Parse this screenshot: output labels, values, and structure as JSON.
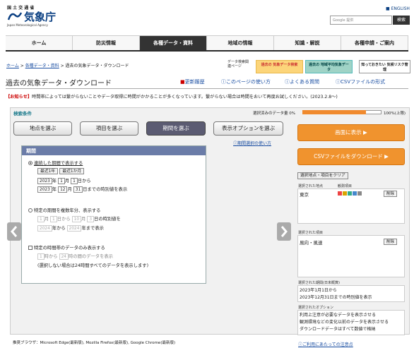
{
  "header": {
    "ministry": "国 土 交 通 省",
    "site_name": "気象庁",
    "site_name_en": "Japan Meteorological Agency",
    "lang_link": "ENGLISH",
    "search_placeholder": "Google 提供",
    "search_button": "検索"
  },
  "nav": [
    "ホーム",
    "防災情報",
    "各種データ・資料",
    "地域の情報",
    "知識・解説",
    "各種申請・ご案内"
  ],
  "breadcrumb": {
    "home": "ホーム",
    "data": "各種データ・資料",
    "current": "過去の気象データ・ダウンロード"
  },
  "related": {
    "label": "データ検索関連ページ",
    "banner1": "過去の 気象データ検索",
    "banner2": "過去の 地域平均気象データ",
    "banner3": "知っておきたい 気候リスク管理"
  },
  "page_title": "過去の気象データ・ダウンロード",
  "title_links": [
    "更新履歴",
    "このページの使い方",
    "よくある質問",
    "CSVファイルの形式"
  ],
  "notice": {
    "tag": "【お知らせ】",
    "text": "時間帯によっては繋がらないことやデータ取得に時間がかかることが多くなっています。繋がらない場合は時間をおいて再度お試しください。(2023.2.8～)"
  },
  "panel": {
    "search_conditions": "検索条件",
    "qty_label": "選択済みのデータ量 0%",
    "qty_max": "100%(上限)",
    "qty_fraction": 0.8,
    "steps": [
      "地点を選ぶ",
      "項目を選ぶ",
      "期間を選ぶ",
      "表示オプションを選ぶ"
    ],
    "help_link": "期間選択の使い方"
  },
  "period": {
    "title": "期間",
    "opt1": {
      "label": "連続した期間で表示する",
      "btn_year": "最近1年",
      "btn_month": "最近1か月",
      "from_year": "2023",
      "from_month": "1",
      "from_day": "1",
      "from_suffix": "日から",
      "to_year": "2023",
      "to_month": "12",
      "to_day": "31",
      "to_suffix": "日までの時別値を表示"
    },
    "opt2": {
      "label": "特定の期間を複数年分、表示する",
      "m1": "1",
      "d1": "1",
      "m2": "10",
      "d2": "3",
      "suffix1": "日の時別値を",
      "y1": "2024",
      "y2": "2024",
      "suffix2": "年まで表示"
    },
    "opt3": {
      "label": "特定の時間帯のデータのみ表示する",
      "h1": "1",
      "h2": "24",
      "suffix": "時の間のデータを表示",
      "note": "(選択しない場合は24時間すべてのデータを表示します)"
    },
    "units": {
      "year": "年",
      "month": "月",
      "day": "日",
      "from": "日から",
      "year_from": "年から",
      "hour_from": "時から"
    }
  },
  "right": {
    "show_btn": "画面に表示 ▶",
    "csv_btn": "CSVファイルをダウンロード ▶",
    "clear_btn": "選択地点・項目をクリア",
    "sel_stations_head": "選択された地点",
    "obs_items_head": "観測項目",
    "station": "東京",
    "delete": "削除",
    "sel_items_head": "選択された項目",
    "item": "風向・風速",
    "sel_period_head": "選択された期間(日未概算)",
    "period_from": "2023年1月1日から",
    "period_to": "2023年12月31日までの時別値を表示",
    "sel_options_head": "選択されたオプション",
    "opt1": "利用上注意が必要なデータを表示させる",
    "opt2": "観測環境などの変化以前のデータを表示させる",
    "opt3": "ダウンロードデータはすべて数値で格納",
    "caution_link": "ご利用にあたっての注意点"
  },
  "footer_note": "推奨ブラウザ：Microsoft Edge(最新版), Mozilla Firefox(最新版), Google Chrome(最新版)",
  "colors": {
    "accent": "#f0932e",
    "nav_active": "#333333",
    "period_head": "#6b7ca8",
    "link": "#1a4ea2"
  }
}
